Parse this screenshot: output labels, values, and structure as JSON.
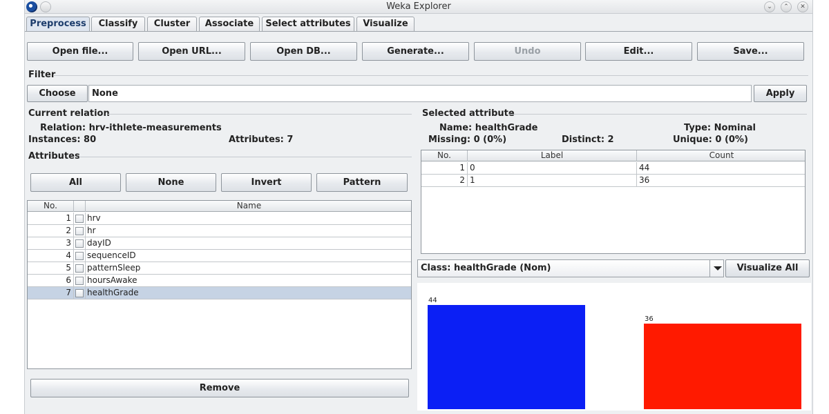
{
  "window": {
    "title": "Weka Explorer"
  },
  "tabs": [
    {
      "label": "Preprocess",
      "active": true
    },
    {
      "label": "Classify",
      "active": false
    },
    {
      "label": "Cluster",
      "active": false
    },
    {
      "label": "Associate",
      "active": false
    },
    {
      "label": "Select attributes",
      "active": false
    },
    {
      "label": "Visualize",
      "active": false
    }
  ],
  "toolbar": {
    "open_file": "Open file...",
    "open_url": "Open URL...",
    "open_db": "Open DB...",
    "generate": "Generate...",
    "undo": "Undo",
    "edit": "Edit...",
    "save": "Save..."
  },
  "filter": {
    "label": "Filter",
    "choose": "Choose",
    "value": "None",
    "apply": "Apply"
  },
  "current_relation": {
    "label": "Current relation",
    "relation": "Relation: hrv-ithlete-measurements",
    "instances": "Instances: 80",
    "attributes": "Attributes: 7"
  },
  "attributes": {
    "label": "Attributes",
    "buttons": {
      "all": "All",
      "none": "None",
      "invert": "Invert",
      "pattern": "Pattern"
    },
    "columns": {
      "no": "No.",
      "name": "Name"
    },
    "rows": [
      {
        "no": "1",
        "name": "hrv",
        "selected": false
      },
      {
        "no": "2",
        "name": "hr",
        "selected": false
      },
      {
        "no": "3",
        "name": "dayID",
        "selected": false
      },
      {
        "no": "4",
        "name": "sequenceID",
        "selected": false
      },
      {
        "no": "5",
        "name": "patternSleep",
        "selected": false
      },
      {
        "no": "6",
        "name": "hoursAwake",
        "selected": false
      },
      {
        "no": "7",
        "name": "healthGrade",
        "selected": true
      }
    ],
    "remove": "Remove"
  },
  "selected_attribute": {
    "label": "Selected attribute",
    "name": "Name: healthGrade",
    "type": "Type: Nominal",
    "missing": "Missing: 0 (0%)",
    "distinct": "Distinct: 2",
    "unique": "Unique: 0 (0%)",
    "columns": {
      "no": "No.",
      "label": "Label",
      "count": "Count"
    },
    "rows": [
      {
        "no": "1",
        "label": "0",
        "count": "44"
      },
      {
        "no": "2",
        "label": "1",
        "count": "36"
      }
    ]
  },
  "class_select": {
    "value": "Class: healthGrade (Nom)",
    "visualize_all": "Visualize All"
  },
  "chart_data": {
    "type": "bar",
    "categories": [
      "0",
      "1"
    ],
    "values": [
      44,
      36
    ],
    "colors": [
      "#0b1ff5",
      "#ff1a00"
    ],
    "ylim": [
      0,
      44
    ],
    "grid": false,
    "legend": "none"
  }
}
